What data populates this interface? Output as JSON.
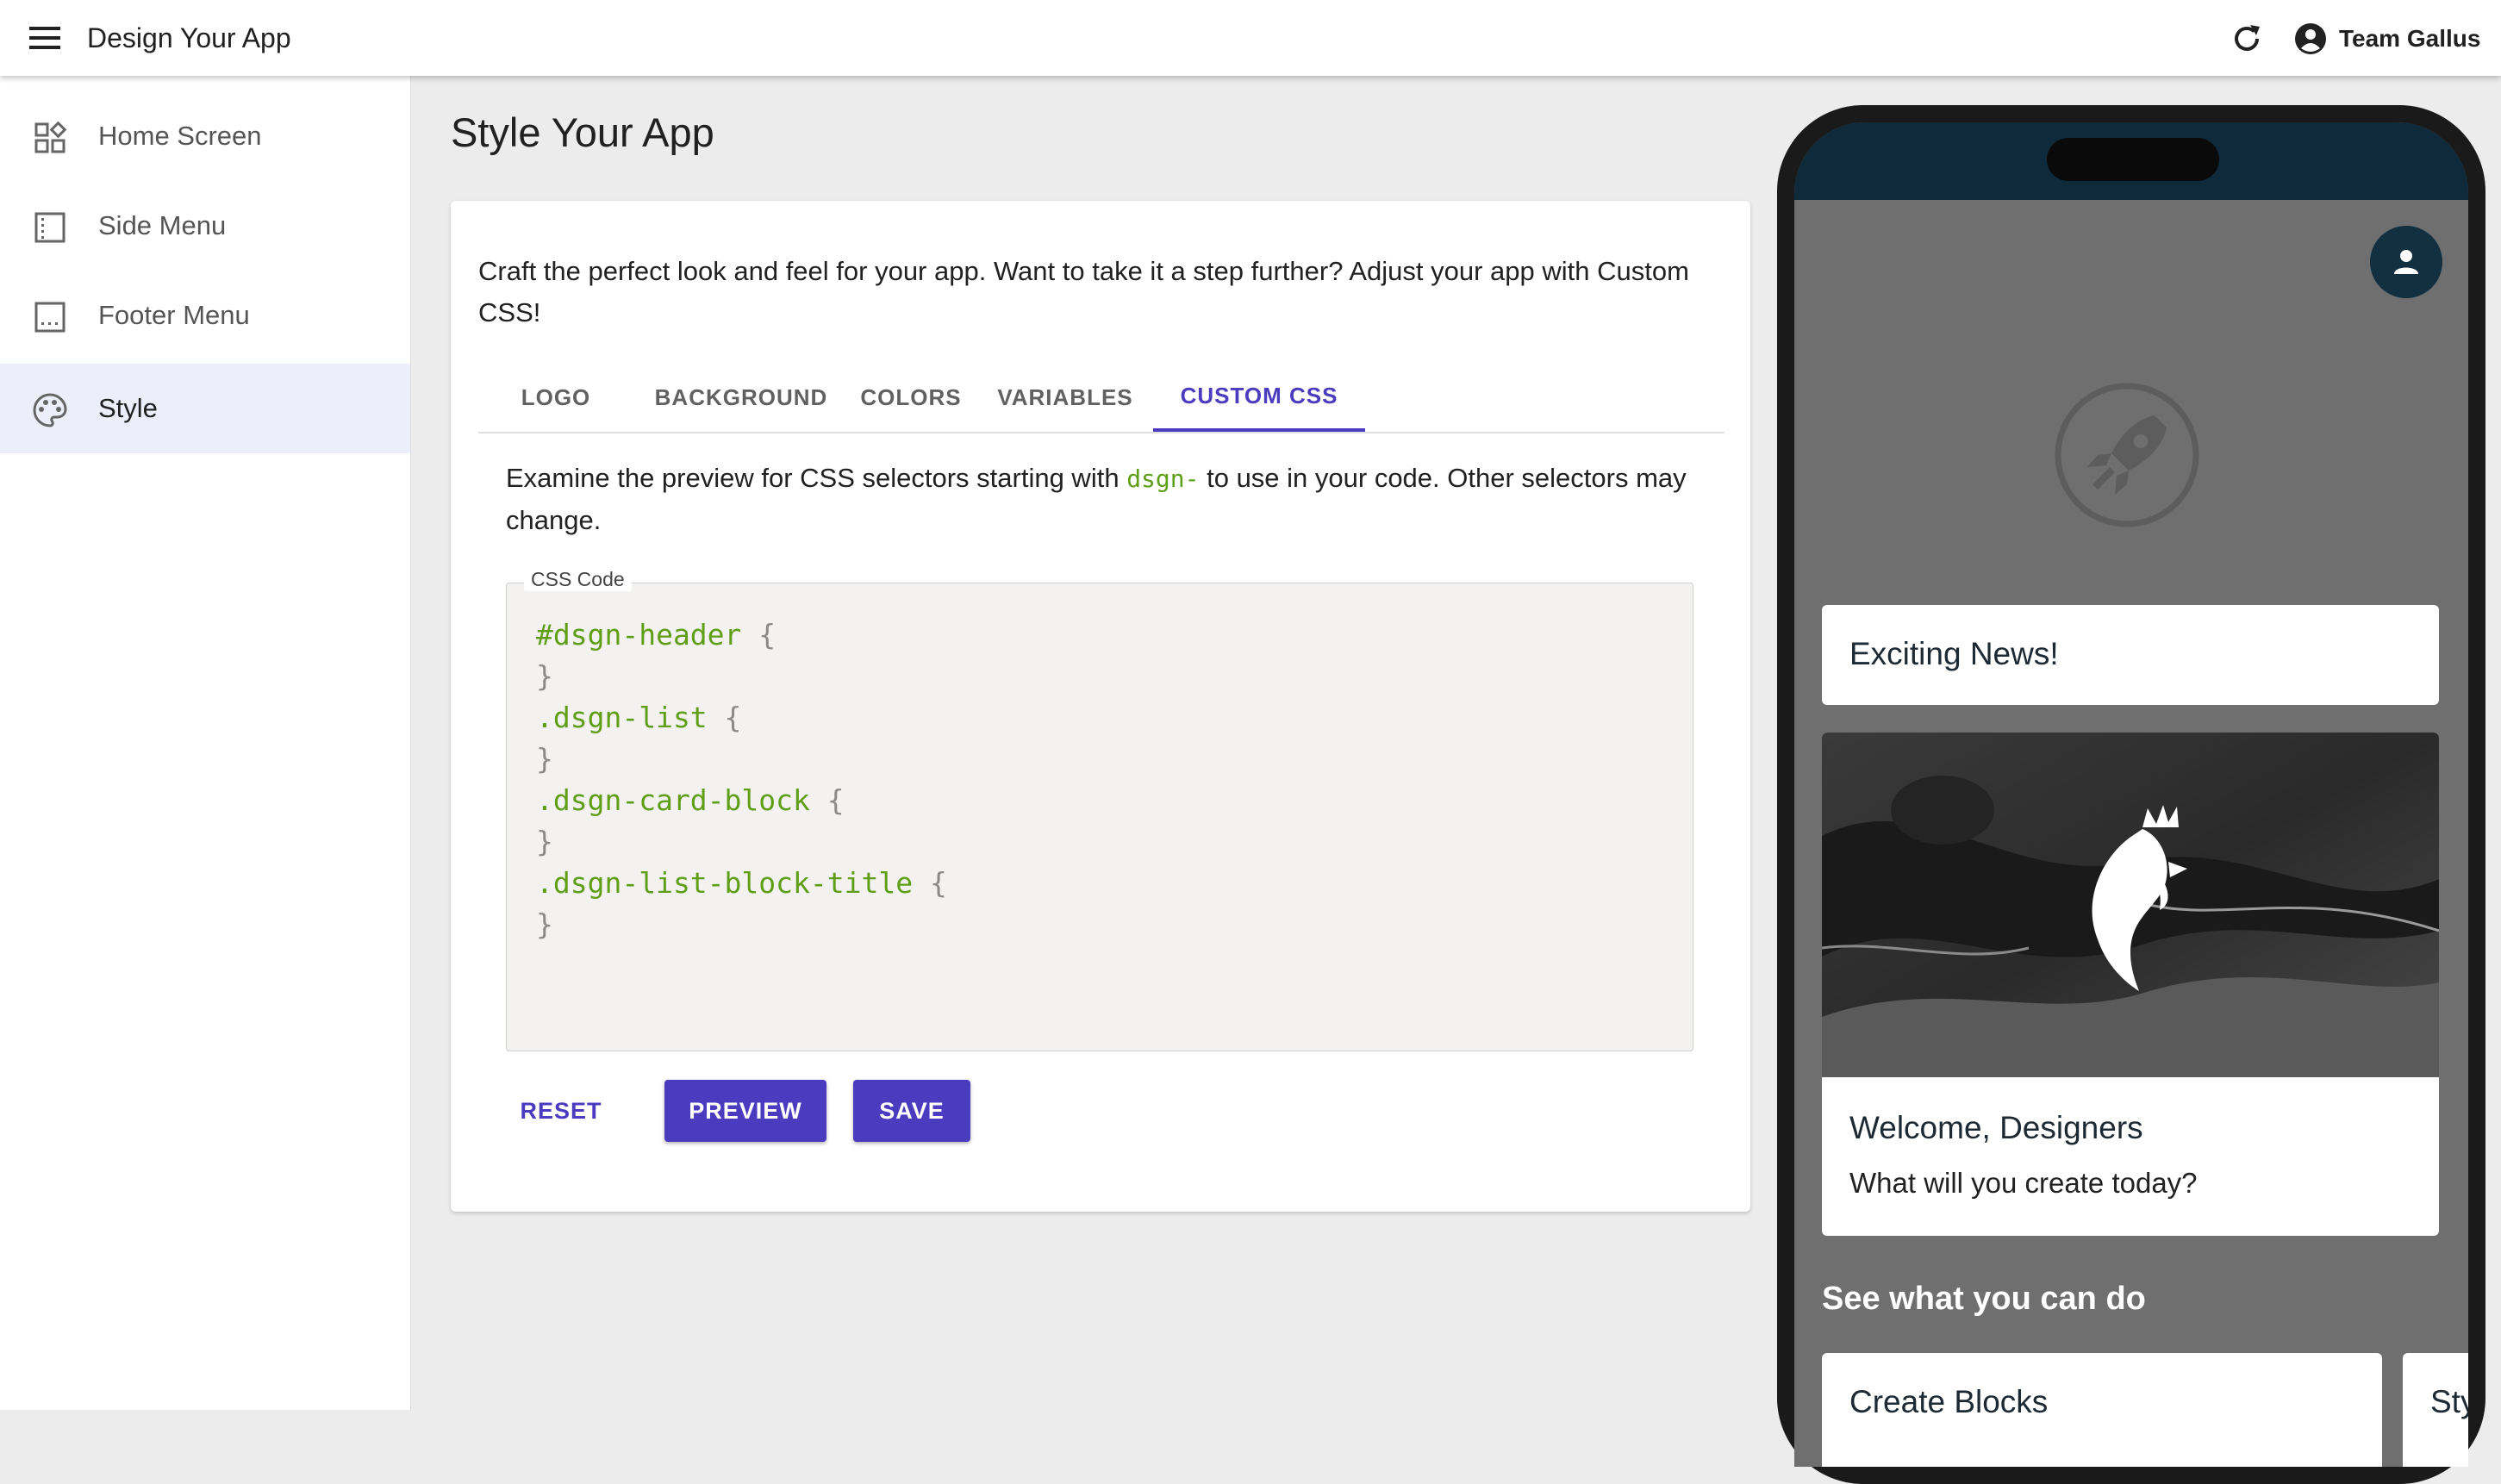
{
  "appbar": {
    "title": "Design Your App",
    "user": "Team Gallus",
    "icons": [
      "menu-icon",
      "refresh-icon",
      "account-circle-icon"
    ]
  },
  "sidebar": {
    "items": [
      {
        "label": "Home Screen",
        "icon": "dashboard-customize-icon",
        "active": false
      },
      {
        "label": "Side Menu",
        "icon": "side-menu-icon",
        "active": false
      },
      {
        "label": "Footer Menu",
        "icon": "footer-menu-icon",
        "active": false
      },
      {
        "label": "Style",
        "icon": "palette-icon",
        "active": true
      }
    ]
  },
  "main": {
    "title": "Style Your App",
    "intro": "Craft the perfect look and feel for your app. Want to take it a step further? Adjust your app with Custom CSS!",
    "tabs": [
      {
        "label": "LOGO",
        "active": false
      },
      {
        "label": "BACKGROUND",
        "active": false
      },
      {
        "label": "COLORS",
        "active": false
      },
      {
        "label": "VARIABLES",
        "active": false
      },
      {
        "label": "CUSTOM CSS",
        "active": true
      }
    ],
    "hint": {
      "before": "Examine the preview for CSS selectors starting with ",
      "code": "dsgn-",
      "after": " to use in your code. Other selectors may change."
    },
    "css_field": {
      "label": "CSS Code",
      "lines": [
        {
          "selector": "#dsgn-header",
          "open": " {",
          "close": "}"
        },
        {
          "selector": ".dsgn-list",
          "open": " {",
          "close": "}"
        },
        {
          "selector": ".dsgn-card-block",
          "open": " {",
          "close": "}"
        },
        {
          "selector": ".dsgn-list-block-title",
          "open": " {",
          "close": "}"
        }
      ]
    },
    "buttons": {
      "reset": "RESET",
      "preview": "PREVIEW",
      "save": "SAVE"
    },
    "accent_color": "#4a3bbf",
    "code_color": "#5f9e17"
  },
  "preview": {
    "news_title": "Exciting News!",
    "welcome_title": "Welcome, Designers",
    "welcome_subtitle": "What will you create today?",
    "section_title": "See what you can do",
    "blocks": [
      "Create Blocks",
      "Sty"
    ],
    "icons": [
      "person-icon",
      "rocket-logo-icon",
      "rooster-image"
    ],
    "header_color": "#0f2a3b",
    "background_color": "#6f6f6f"
  }
}
